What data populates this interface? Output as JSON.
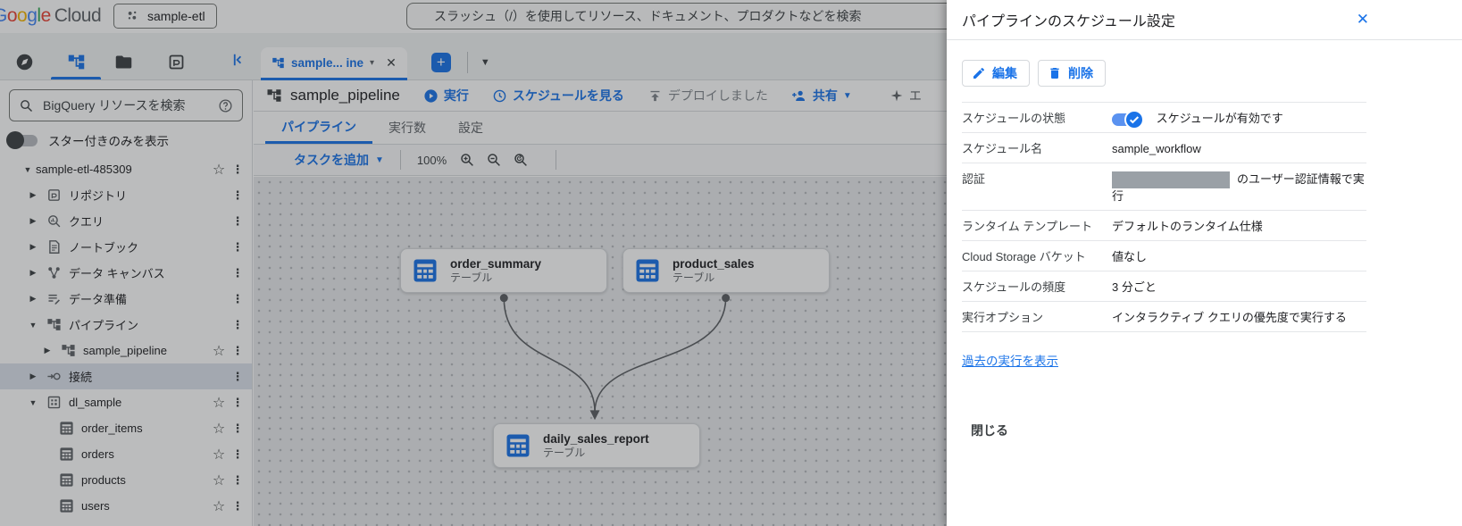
{
  "header": {
    "logo_letters": [
      "G",
      "o",
      "o",
      "g",
      "l",
      "e"
    ],
    "logo_suffix": "Cloud",
    "project_selector": "sample-etl",
    "search_placeholder": "スラッシュ（/）を使用してリソース、ドキュメント、プロダクトなどを検索"
  },
  "sidebar": {
    "search_placeholder": "BigQuery リソースを検索",
    "starred_toggle_label": "スター付きのみを表示",
    "tree": [
      {
        "label": "sample-etl-485309",
        "icon": "none"
      },
      {
        "label": "リポジトリ",
        "icon": "repository-icon"
      },
      {
        "label": "クエリ",
        "icon": "query-icon"
      },
      {
        "label": "ノートブック",
        "icon": "notebook-icon"
      },
      {
        "label": "データ キャンバス",
        "icon": "data-canvas-icon"
      },
      {
        "label": "データ準備",
        "icon": "data-prep-icon"
      },
      {
        "label": "パイプライン",
        "icon": "pipeline-icon"
      },
      {
        "label": "sample_pipeline",
        "icon": "pipeline-icon"
      },
      {
        "label": "接続",
        "icon": "connection-icon"
      },
      {
        "label": "dl_sample",
        "icon": "dataset-icon"
      },
      {
        "label": "order_items",
        "icon": "table-icon"
      },
      {
        "label": "orders",
        "icon": "table-icon"
      },
      {
        "label": "products",
        "icon": "table-icon"
      },
      {
        "label": "users",
        "icon": "table-icon"
      }
    ]
  },
  "main": {
    "doc_tab_label": "sample... ine",
    "toolbar": {
      "title": "sample_pipeline",
      "run": "実行",
      "view_schedule": "スケジュールを見る",
      "deployed": "デプロイしました",
      "share": "共有",
      "clipped": "エ"
    },
    "tabs": [
      "パイプライン",
      "実行数",
      "設定"
    ],
    "canvas_toolbar": {
      "add_task": "タスクを追加",
      "zoom_level": "100%"
    },
    "nodes": [
      {
        "title": "order_summary",
        "subtitle": "テーブル"
      },
      {
        "title": "product_sales",
        "subtitle": "テーブル"
      },
      {
        "title": "daily_sales_report",
        "subtitle": "テーブル"
      }
    ]
  },
  "panel": {
    "title": "パイプラインのスケジュール設定",
    "edit_button": "編集",
    "delete_button": "削除",
    "rows": [
      {
        "label": "スケジュールの状態",
        "value": "スケジュールが有効です"
      },
      {
        "label": "スケジュール名",
        "value": "sample_workflow"
      },
      {
        "label": "認証",
        "value": "のユーザー認証情報で実行"
      },
      {
        "label": "ランタイム テンプレート",
        "value": "デフォルトのランタイム仕様"
      },
      {
        "label": "Cloud Storage バケット",
        "value": "値なし"
      },
      {
        "label": "スケジュールの頻度",
        "value": "3 分ごと"
      },
      {
        "label": "実行オプション",
        "value": "インタラクティブ クエリの優先度で実行する"
      }
    ],
    "past_runs_link": "過去の実行を表示",
    "close_button": "閉じる"
  },
  "colors": {
    "accent_blue": "#1a73e8",
    "text_dark": "#202124",
    "text_gray": "#5f6368",
    "border": "#dadce0",
    "canvas_bg": "#e8eaed",
    "redacted_gray": "#9aa0a6"
  }
}
